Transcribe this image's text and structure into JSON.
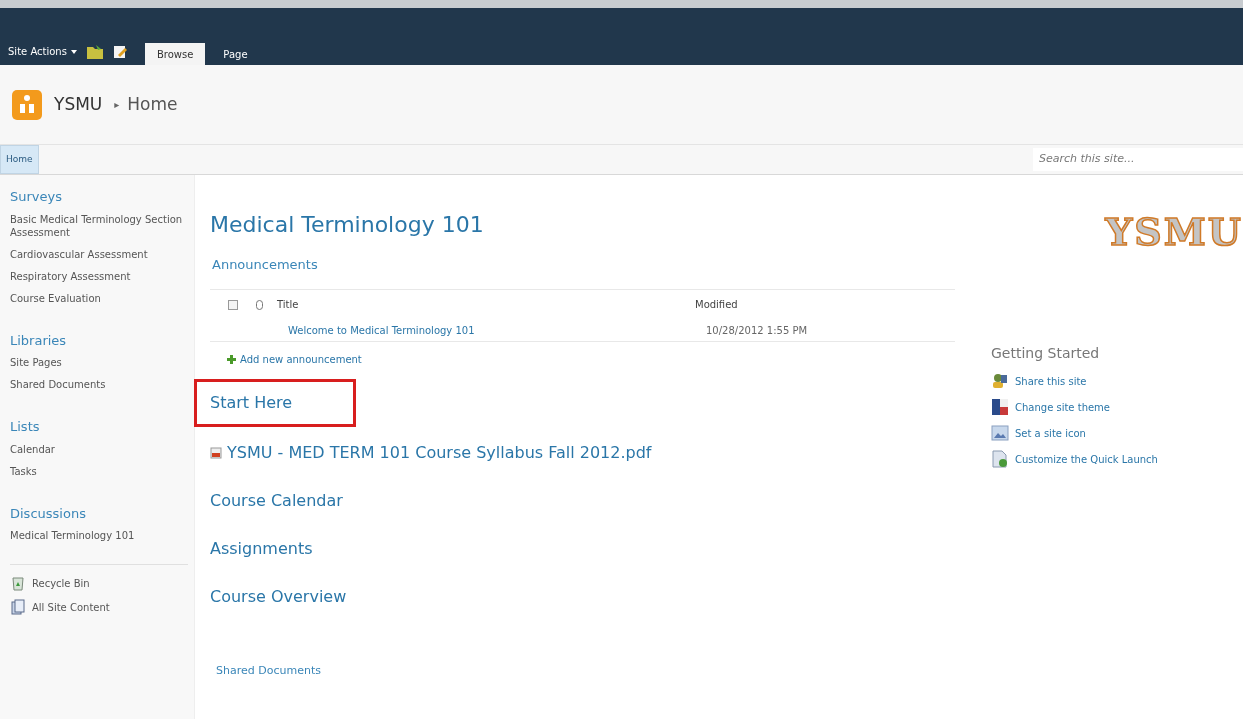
{
  "ribbon": {
    "site_actions": "Site Actions",
    "tabs": [
      {
        "label": "Browse",
        "selected": true
      },
      {
        "label": "Page",
        "selected": false
      }
    ]
  },
  "breadcrumb": {
    "site": "YSMU",
    "separator": "▸",
    "page": "Home"
  },
  "top_nav": {
    "tabs": [
      {
        "label": "Home",
        "selected": true
      }
    ],
    "search": {
      "placeholder": "Search this site..."
    }
  },
  "quick_launch": {
    "sections": [
      {
        "heading": "Surveys",
        "items": [
          "Basic Medical Terminology Section Assessment",
          "Cardiovascular Assessment",
          "Respiratory Assessment",
          "Course Evaluation"
        ]
      },
      {
        "heading": "Libraries",
        "items": [
          "Site Pages",
          "Shared Documents"
        ]
      },
      {
        "heading": "Lists",
        "items": [
          "Calendar",
          "Tasks"
        ]
      },
      {
        "heading": "Discussions",
        "items": [
          "Medical Terminology 101"
        ]
      }
    ],
    "footer": [
      {
        "kind": "recycle",
        "label": "Recycle Bin"
      },
      {
        "kind": "content",
        "label": "All Site Content"
      }
    ]
  },
  "main": {
    "title": "Medical Terminology 101",
    "announcements": {
      "heading": "Announcements",
      "columns": [
        "Title",
        "Modified"
      ],
      "rows": [
        {
          "title": "Welcome to Medical Terminology 101",
          "modified": "10/28/2012 1:55 PM",
          "checked": false
        }
      ],
      "add_link": "Add new announcement"
    },
    "links": [
      {
        "kind": "heading",
        "label": "Start Here",
        "highlighted": true
      },
      {
        "kind": "document",
        "label": "YSMU - MED TERM 101 Course Syllabus Fall 2012.pdf",
        "highlighted": false
      },
      {
        "kind": "heading",
        "label": "Course Calendar",
        "highlighted": false
      },
      {
        "kind": "heading",
        "label": "Assignments",
        "highlighted": false
      },
      {
        "kind": "heading",
        "label": "Course Overview",
        "highlighted": false
      }
    ],
    "shared_documents": "Shared Documents"
  },
  "right": {
    "logo": "YSMU",
    "getting_started": {
      "heading": "Getting Started",
      "items": [
        {
          "kind": "share",
          "label": "Share this site"
        },
        {
          "kind": "theme",
          "label": "Change site theme"
        },
        {
          "kind": "icon",
          "label": "Set a site icon"
        },
        {
          "kind": "launch",
          "label": "Customize the Quick Launch"
        }
      ]
    }
  }
}
